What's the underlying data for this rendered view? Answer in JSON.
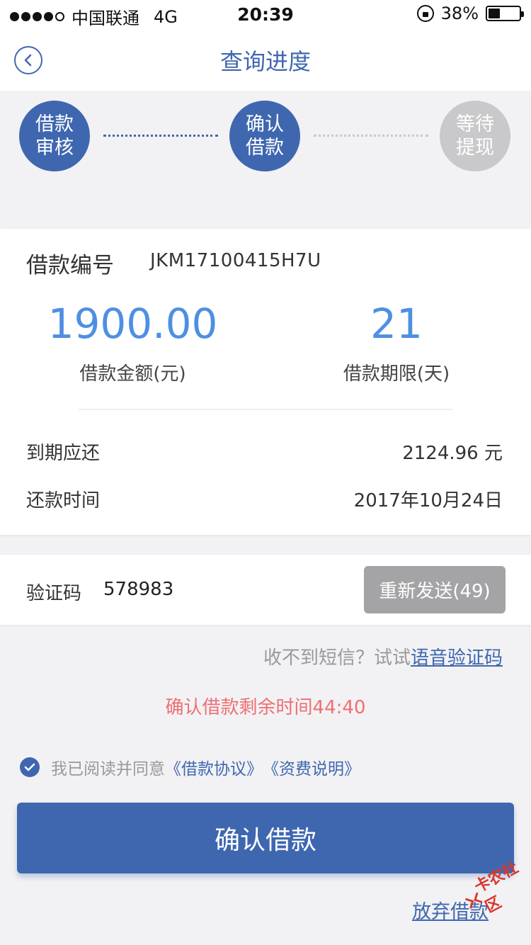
{
  "status_bar": {
    "carrier": "中国联通",
    "network": "4G",
    "time": "20:39",
    "battery": "38%",
    "battery_level": 0.38
  },
  "nav": {
    "back_icon": "chevron-left-icon",
    "title": "查询进度"
  },
  "steps": [
    {
      "line1": "借款",
      "line2": "审核",
      "state": "done"
    },
    {
      "line1": "确认",
      "line2": "借款",
      "state": "current"
    },
    {
      "line1": "等待",
      "line2": "提现",
      "state": "pending"
    }
  ],
  "loan": {
    "number_label": "借款编号",
    "number_value": "JKM17100415H7U",
    "amount_value": "1900.00",
    "amount_label": "借款金额(元)",
    "term_value": "21",
    "term_label": "借款期限(天)",
    "due_label": "到期应还",
    "due_value": "2124.96 元",
    "repay_time_label": "还款时间",
    "repay_time_value": "2017年10月24日"
  },
  "verification": {
    "label": "验证码",
    "value": "578983",
    "resend_label": "重新发送(49)"
  },
  "sms_hint": {
    "text": "收不到短信？试试",
    "link": "语音验证码"
  },
  "countdown": "确认借款剩余时间44:40",
  "agreement": {
    "text": "我已阅读并同意",
    "loan_agreement": "《借款协议》",
    "fee_description": "《资费说明》",
    "checked": true
  },
  "confirm_button": "确认借款",
  "abandon_link": "放弃借款",
  "watermark": "卡农社区",
  "colors": {
    "primary": "#3f67b0",
    "amount_blue": "#4e8fe3",
    "countdown_red": "#ef6f73",
    "disabled_gray": "#a4a4a6",
    "pending_gray": "#c9c9cb",
    "background": "#f2f2f4"
  }
}
